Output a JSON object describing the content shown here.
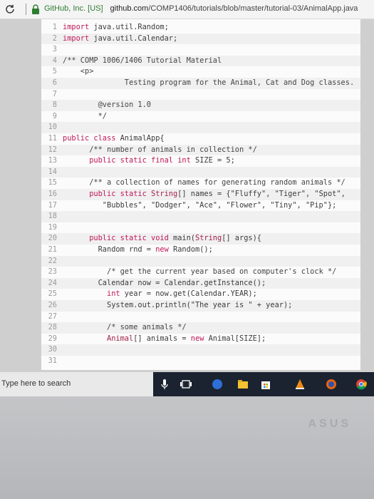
{
  "address_bar": {
    "site": "GitHub, Inc. [US]",
    "domain": "github.com",
    "path": "/COMP1406/tutorials/blob/master/tutorial-03/AnimalApp.java"
  },
  "code": {
    "lines": [
      {
        "n": "1",
        "html": "<span class='kw'>import</span> java.util.Random;"
      },
      {
        "n": "2",
        "html": "<span class='kw'>import</span> java.util.Calendar;"
      },
      {
        "n": "3",
        "html": ""
      },
      {
        "n": "4",
        "html": "<span class='cm'>/** COMP 1006/1406 Tutorial Material</span>"
      },
      {
        "n": "5",
        "html": "<span class='cm'>    &lt;p&gt;</span>"
      },
      {
        "n": "6",
        "html": "<span class='cm'>              Testing program for the Animal, Cat and Dog classes.</span>"
      },
      {
        "n": "7",
        "html": ""
      },
      {
        "n": "8",
        "html": "<span class='cm'>        @version 1.0</span>"
      },
      {
        "n": "9",
        "html": "<span class='cm'>        */</span>"
      },
      {
        "n": "10",
        "html": ""
      },
      {
        "n": "11",
        "html": "<span class='kw'>public class</span> AnimalApp{"
      },
      {
        "n": "12",
        "html": "      <span class='cm'>/** number of animals in collection */</span>"
      },
      {
        "n": "13",
        "html": "      <span class='kw'>public static final int</span> SIZE = 5;"
      },
      {
        "n": "14",
        "html": ""
      },
      {
        "n": "15",
        "html": "      <span class='cm'>/** a collection of names for generating random animals */</span>"
      },
      {
        "n": "16",
        "html": "      <span class='kw'>public static</span> <span class='ty'>String</span>[] names = {\"Fluffy\", \"Tiger\", \"Spot\","
      },
      {
        "n": "17",
        "html": "         \"Bubbles\", \"Dodger\", \"Ace\", \"Flower\", \"Tiny\", \"Pip\"};"
      },
      {
        "n": "18",
        "html": ""
      },
      {
        "n": "19",
        "html": ""
      },
      {
        "n": "20",
        "html": "      <span class='kw'>public static void</span> main(<span class='ty'>String</span>[] args){"
      },
      {
        "n": "21",
        "html": "        Random rnd = <span class='kw'>new</span> Random();"
      },
      {
        "n": "22",
        "html": ""
      },
      {
        "n": "23",
        "html": "          <span class='cm'>/* get the current year based on computer's clock */</span>"
      },
      {
        "n": "24",
        "html": "        Calendar now = Calendar.getInstance();"
      },
      {
        "n": "25",
        "html": "          <span class='kw'>int</span> year = now.get(Calendar.YEAR);"
      },
      {
        "n": "26",
        "html": "          System.out.println(\"The year is \" + year);"
      },
      {
        "n": "27",
        "html": ""
      },
      {
        "n": "28",
        "html": "          <span class='cm'>/* some animals */</span>"
      },
      {
        "n": "29",
        "html": "          <span class='ty'>Animal</span>[] animals = <span class='kw'>new</span> Animal[SIZE];"
      },
      {
        "n": "30",
        "html": ""
      },
      {
        "n": "31",
        "html": ""
      }
    ]
  },
  "taskbar": {
    "search_placeholder": "Type here to search"
  },
  "bezel": {
    "brand": "ASUS"
  },
  "colors": {
    "keyword": "#c0185a",
    "taskbar": "#1b2330"
  }
}
